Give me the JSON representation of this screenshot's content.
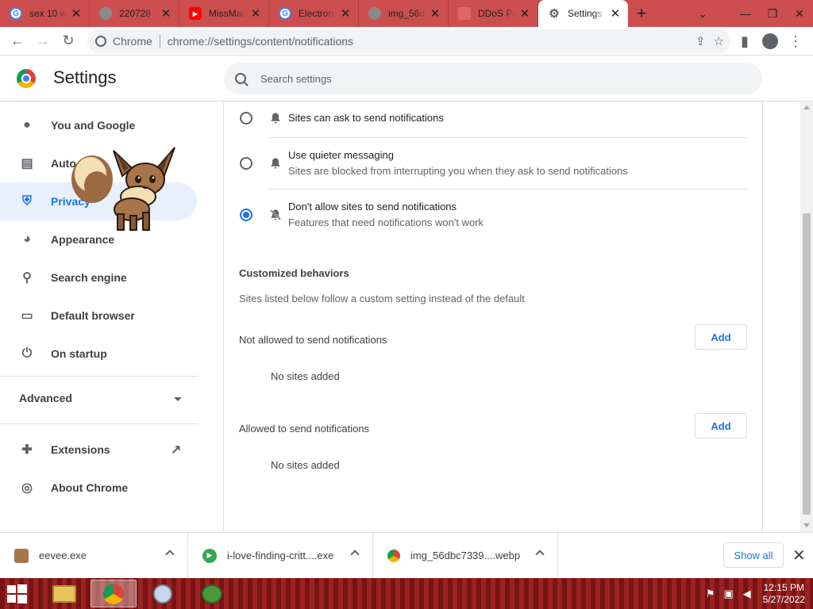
{
  "tabs": [
    {
      "title": "sex 10 w",
      "favicon": "google-icon",
      "color": "#4285f4"
    },
    {
      "title": "220728",
      "favicon": "globe-icon",
      "color": "#5f6368"
    },
    {
      "title": "MissMac",
      "favicon": "youtube-icon",
      "color": "#ff0000"
    },
    {
      "title": "Electron",
      "favicon": "google-icon",
      "color": "#4285f4"
    },
    {
      "title": "img_56d",
      "favicon": "globe-icon",
      "color": "#5f6368"
    },
    {
      "title": "DDoS Pr",
      "favicon": "page-icon",
      "color": "#e06666"
    },
    {
      "title": "Settings",
      "favicon": "gear-icon",
      "color": "#5f6368"
    }
  ],
  "omnibox": {
    "chip": "Chrome",
    "url": "chrome://settings/content/notifications"
  },
  "header": {
    "title": "Settings",
    "search_placeholder": "Search settings"
  },
  "sidebar": {
    "items": [
      {
        "label": "You and Google",
        "icon": "person-icon"
      },
      {
        "label": "Autofill",
        "icon": "clipboard-icon"
      },
      {
        "label": "Privacy and security",
        "icon": "shield-icon"
      },
      {
        "label": "Appearance",
        "icon": "palette-icon"
      },
      {
        "label": "Search engine",
        "icon": "search-icon"
      },
      {
        "label": "Default browser",
        "icon": "browser-icon"
      },
      {
        "label": "On startup",
        "icon": "power-icon"
      }
    ],
    "visible_labels": [
      "You and Google",
      "Auto",
      "Privacy",
      "Appearance",
      "Search engine",
      "Default browser",
      "On startup"
    ],
    "advanced": "Advanced",
    "extensions": "Extensions",
    "about": "About Chrome"
  },
  "main": {
    "options": [
      {
        "title": "Sites can ask to send notifications",
        "subtitle": "",
        "selected": false,
        "icon": "bell-icon"
      },
      {
        "title": "Use quieter messaging",
        "subtitle": "Sites are blocked from interrupting you when they ask to send notifications",
        "selected": false,
        "icon": "bell-icon"
      },
      {
        "title": "Don't allow sites to send notifications",
        "subtitle": "Features that need notifications won't work",
        "selected": true,
        "icon": "bell-off-icon"
      }
    ],
    "custom_heading": "Customized behaviors",
    "custom_sub": "Sites listed below follow a custom setting instead of the default",
    "not_allowed_label": "Not allowed to send notifications",
    "allowed_label": "Allowed to send notifications",
    "add_label": "Add",
    "no_sites": "No sites added"
  },
  "downloads": {
    "items": [
      {
        "name": "eevee.exe",
        "icon": "eevee-icon"
      },
      {
        "name": "i-love-finding-critt....exe",
        "icon": "play-icon"
      },
      {
        "name": "img_56dbc7339....webp",
        "icon": "chrome-icon"
      }
    ],
    "show_all": "Show all"
  },
  "taskbar": {
    "time": "12:15 PM",
    "date": "5/27/2022"
  },
  "colors": {
    "accent": "#1a73e8",
    "tabstrip": "#cd4e4e",
    "taskbar": "#8a1a1a"
  }
}
